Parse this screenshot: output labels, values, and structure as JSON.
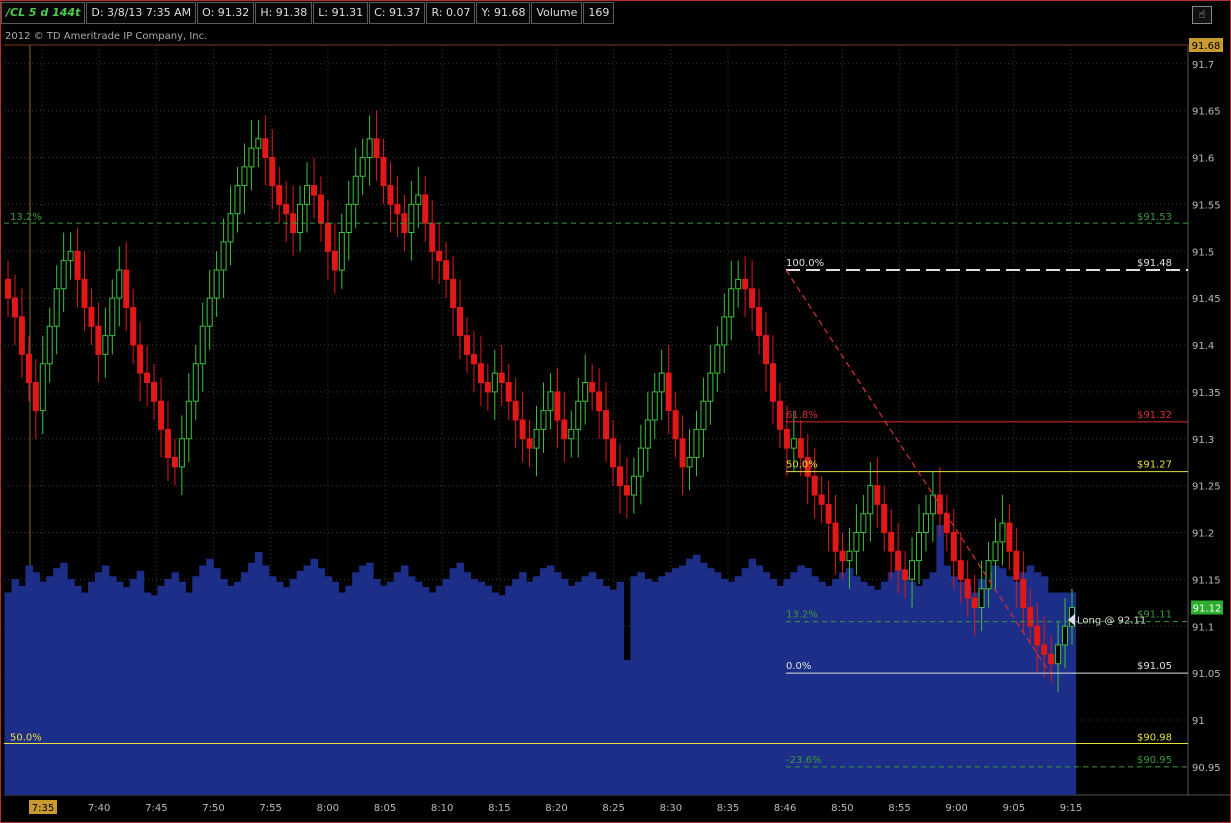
{
  "header": {
    "symbol": "/CL 5 d 144t",
    "date": "D: 3/8/13 7:35 AM",
    "open": "O: 91.32",
    "high": "H: 91.38",
    "low": "L: 91.31",
    "close": "C: 91.37",
    "range": "R: 0.07",
    "y": "Y: 91.68",
    "volume_label": "Volume",
    "volume": "169"
  },
  "copyright": "2012 © TD Ameritrade IP Company, Inc.",
  "corner_icon": "cursor-icon",
  "colors": {
    "up": "#3fbf3f",
    "down": "#e01818",
    "volume": "#1c2e88",
    "grid": "#3a3a3a"
  },
  "chart_data": {
    "type": "candlestick",
    "ylim": [
      90.92,
      91.72
    ],
    "yticks": [
      "91.7",
      "91.65",
      "91.6",
      "91.55",
      "91.5",
      "91.45",
      "91.4",
      "91.35",
      "91.3",
      "91.25",
      "91.2",
      "91.15",
      "91.1",
      "91.05",
      "91",
      "90.95"
    ],
    "xticks": [
      "7:35",
      "7:40",
      "7:45",
      "7:50",
      "7:55",
      "8:00",
      "8:05",
      "8:10",
      "8:15",
      "8:20",
      "8:25",
      "8:30",
      "8:35",
      "8:46",
      "8:50",
      "8:55",
      "9:00",
      "9:05",
      "9:15"
    ],
    "current_time": "7:35",
    "last_price": "91.68",
    "current_price": "91.12",
    "closes": [
      91.45,
      91.43,
      91.39,
      91.36,
      91.33,
      91.38,
      91.42,
      91.46,
      91.49,
      91.5,
      91.47,
      91.44,
      91.42,
      91.39,
      91.41,
      91.45,
      91.48,
      91.44,
      91.4,
      91.37,
      91.36,
      91.34,
      91.31,
      91.28,
      91.27,
      91.3,
      91.34,
      91.38,
      91.42,
      91.45,
      91.48,
      91.51,
      91.54,
      91.57,
      91.59,
      91.61,
      91.62,
      91.6,
      91.57,
      91.55,
      91.54,
      91.52,
      91.55,
      91.57,
      91.56,
      91.53,
      91.5,
      91.48,
      91.52,
      91.55,
      91.58,
      91.6,
      91.62,
      91.6,
      91.57,
      91.55,
      91.54,
      91.52,
      91.55,
      91.56,
      91.53,
      91.5,
      91.49,
      91.47,
      91.44,
      91.41,
      91.39,
      91.38,
      91.36,
      91.35,
      91.37,
      91.36,
      91.34,
      91.32,
      91.3,
      91.29,
      91.31,
      91.33,
      91.35,
      91.32,
      91.3,
      91.31,
      91.34,
      91.36,
      91.35,
      91.33,
      91.3,
      91.27,
      91.25,
      91.24,
      91.26,
      91.29,
      91.32,
      91.35,
      91.37,
      91.33,
      91.3,
      91.27,
      91.28,
      91.31,
      91.34,
      91.37,
      91.4,
      91.43,
      91.46,
      91.47,
      91.46,
      91.44,
      91.41,
      91.38,
      91.34,
      91.31,
      91.29,
      91.3,
      91.28,
      91.26,
      91.24,
      91.23,
      91.21,
      91.18,
      91.17,
      91.18,
      91.2,
      91.22,
      91.25,
      91.23,
      91.2,
      91.18,
      91.16,
      91.15,
      91.17,
      91.2,
      91.22,
      91.24,
      91.22,
      91.2,
      91.17,
      91.15,
      91.13,
      91.12,
      91.14,
      91.17,
      91.19,
      91.21,
      91.18,
      91.15,
      91.12,
      91.1,
      91.08,
      91.07,
      91.06,
      91.08,
      91.1,
      91.12
    ],
    "volumes": [
      150,
      160,
      155,
      170,
      165,
      158,
      162,
      168,
      172,
      160,
      155,
      150,
      158,
      165,
      170,
      162,
      158,
      154,
      160,
      166,
      150,
      148,
      155,
      160,
      165,
      158,
      150,
      162,
      170,
      175,
      168,
      160,
      155,
      158,
      165,
      172,
      180,
      170,
      162,
      158,
      154,
      160,
      166,
      170,
      175,
      168,
      162,
      158,
      150,
      155,
      165,
      170,
      172,
      160,
      155,
      158,
      165,
      170,
      162,
      158,
      154,
      150,
      155,
      160,
      168,
      172,
      165,
      160,
      158,
      155,
      150,
      148,
      155,
      160,
      165,
      158,
      162,
      168,
      170,
      165,
      160,
      155,
      158,
      162,
      165,
      160,
      155,
      152,
      158,
      100,
      162,
      165,
      160,
      158,
      162,
      165,
      168,
      170,
      175,
      178,
      172,
      168,
      165,
      160,
      158,
      162,
      168,
      175,
      170,
      165,
      160,
      155,
      160,
      165,
      170,
      168,
      162,
      158,
      155,
      160,
      165,
      168,
      162,
      158,
      155,
      152,
      158,
      165,
      168,
      162,
      158,
      155,
      160,
      165,
      200,
      170,
      162,
      158,
      155,
      150,
      160,
      165,
      170,
      168,
      162,
      158,
      165,
      170,
      165,
      162
    ],
    "fib_left": [
      {
        "label": "13.2%",
        "price": "$91.53",
        "value": 91.53,
        "style": "dashed",
        "color": "#3a9a3a"
      },
      {
        "label": "50.0%",
        "price": "$90.98",
        "value": 90.975,
        "style": "solid",
        "color": "#e8e040"
      }
    ],
    "fib_right": [
      {
        "label": "100.0%",
        "price": "$91.48",
        "value": 91.48,
        "style": "dashed",
        "color": "#e0e0e0"
      },
      {
        "label": "61.8%",
        "price": "$91.32",
        "value": 91.318,
        "style": "solid",
        "color": "#d83030"
      },
      {
        "label": "50.0%",
        "price": "$91.27",
        "value": 91.265,
        "style": "solid",
        "color": "#e8e040"
      },
      {
        "label": "13.2%",
        "price": "$91.11",
        "value": 91.105,
        "style": "dashed",
        "color": "#3a9a3a"
      },
      {
        "label": "0.0%",
        "price": "$91.05",
        "value": 91.05,
        "style": "solid",
        "color": "#e0e0e0"
      },
      {
        "label": "-23.6%",
        "price": "$90.95",
        "value": 90.95,
        "style": "dashed",
        "color": "#3a9a3a"
      }
    ],
    "annotation": "Long @ 92.11"
  }
}
